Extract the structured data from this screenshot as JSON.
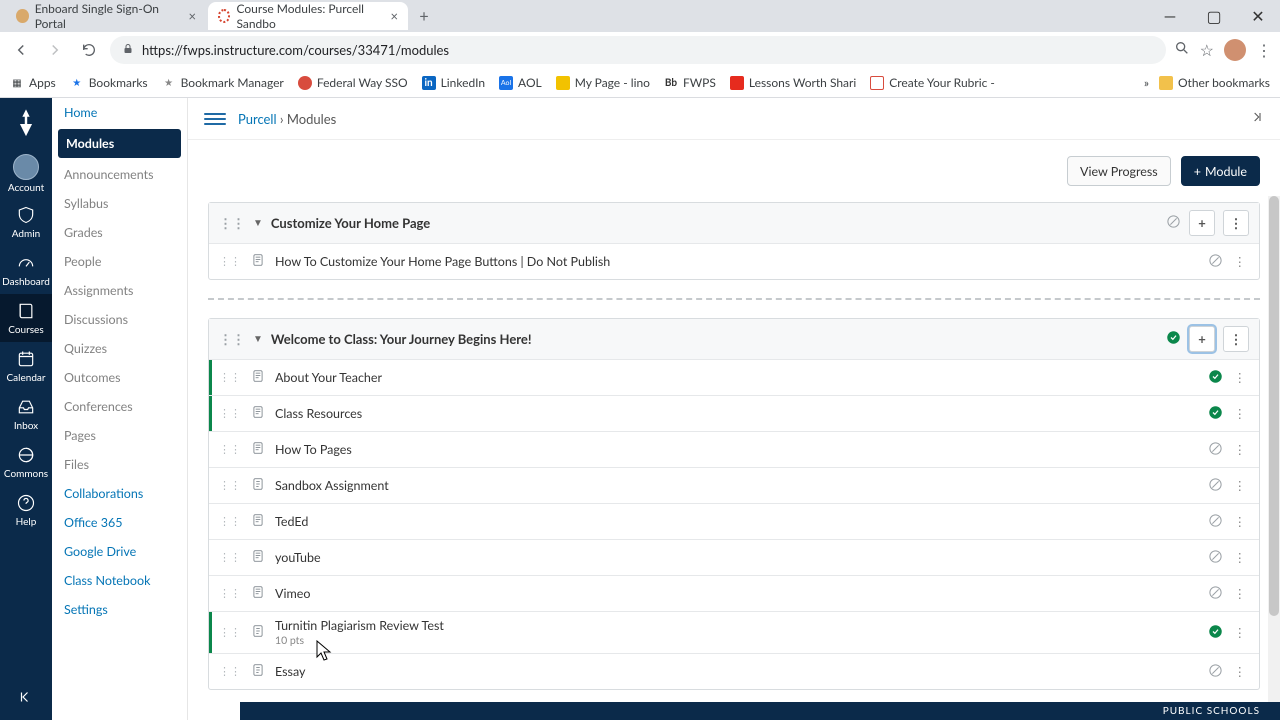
{
  "browser": {
    "tabs": [
      {
        "title": "Enboard Single Sign-On Portal",
        "active": false
      },
      {
        "title": "Course Modules: Purcell Sandbo",
        "active": true
      }
    ],
    "url": "https://fwps.instructure.com/courses/33471/modules",
    "bookmarks": [
      {
        "label": "Apps",
        "icon": "grid",
        "color": "#5f6368"
      },
      {
        "label": "Bookmarks",
        "icon": "star",
        "color": "#1a73e8"
      },
      {
        "label": "Bookmark Manager",
        "icon": "star",
        "color": "#888"
      },
      {
        "label": "Federal Way SSO",
        "icon": "dot",
        "color": "#d84c3e"
      },
      {
        "label": "LinkedIn",
        "icon": "in",
        "color": "#0a66c2"
      },
      {
        "label": "AOL",
        "icon": "aol",
        "color": "#1a73e8"
      },
      {
        "label": "My Page - lino",
        "icon": "lino",
        "color": "#f2c200"
      },
      {
        "label": "FWPS",
        "icon": "bb",
        "color": "#333"
      },
      {
        "label": "Lessons Worth Shari",
        "icon": "ted",
        "color": "#e62b1e"
      },
      {
        "label": "Create Your Rubric -",
        "icon": "r",
        "color": "#d84c3e"
      }
    ],
    "other_bookmarks": "Other bookmarks"
  },
  "global_nav": [
    {
      "key": "account",
      "label": "Account"
    },
    {
      "key": "admin",
      "label": "Admin"
    },
    {
      "key": "dashboard",
      "label": "Dashboard"
    },
    {
      "key": "courses",
      "label": "Courses"
    },
    {
      "key": "calendar",
      "label": "Calendar"
    },
    {
      "key": "inbox",
      "label": "Inbox"
    },
    {
      "key": "commons",
      "label": "Commons"
    },
    {
      "key": "help",
      "label": "Help"
    }
  ],
  "breadcrumb": {
    "course": "Purcell",
    "page": "Modules"
  },
  "course_nav": [
    {
      "label": "Home",
      "enabled": true,
      "active": false
    },
    {
      "label": "Modules",
      "enabled": true,
      "active": true
    },
    {
      "label": "Announcements",
      "enabled": false
    },
    {
      "label": "Syllabus",
      "enabled": false
    },
    {
      "label": "Grades",
      "enabled": false
    },
    {
      "label": "People",
      "enabled": false
    },
    {
      "label": "Assignments",
      "enabled": false
    },
    {
      "label": "Discussions",
      "enabled": false
    },
    {
      "label": "Quizzes",
      "enabled": false
    },
    {
      "label": "Outcomes",
      "enabled": false
    },
    {
      "label": "Conferences",
      "enabled": false
    },
    {
      "label": "Pages",
      "enabled": false
    },
    {
      "label": "Files",
      "enabled": false
    },
    {
      "label": "Collaborations",
      "enabled": true
    },
    {
      "label": "Office 365",
      "enabled": true
    },
    {
      "label": "Google Drive",
      "enabled": true
    },
    {
      "label": "Class Notebook",
      "enabled": true
    },
    {
      "label": "Settings",
      "enabled": true
    }
  ],
  "actions": {
    "view_progress": "View Progress",
    "add_module": "Module"
  },
  "modules": [
    {
      "title": "Customize Your Home Page",
      "published": false,
      "add_highlight": false,
      "items": [
        {
          "title": "How To Customize Your Home Page Buttons | Do Not Publish",
          "type": "page",
          "published": false
        }
      ]
    },
    {
      "title": "Welcome to Class: Your Journey Begins Here!",
      "published": true,
      "add_highlight": true,
      "items": [
        {
          "title": "About Your Teacher",
          "type": "page",
          "published": true
        },
        {
          "title": "Class Resources",
          "type": "page",
          "published": true
        },
        {
          "title": "How To Pages",
          "type": "page",
          "published": false
        },
        {
          "title": "Sandbox Assignment",
          "type": "assignment",
          "published": false
        },
        {
          "title": "TedEd",
          "type": "page",
          "published": false
        },
        {
          "title": "youTube",
          "type": "page",
          "published": false
        },
        {
          "title": "Vimeo",
          "type": "page",
          "published": false
        },
        {
          "title": "Turnitin Plagiarism Review Test",
          "type": "assignment",
          "published": true,
          "sub": "10 pts"
        },
        {
          "title": "Essay",
          "type": "assignment",
          "published": false
        }
      ]
    }
  ],
  "footer": "PUBLIC SCHOOLS"
}
